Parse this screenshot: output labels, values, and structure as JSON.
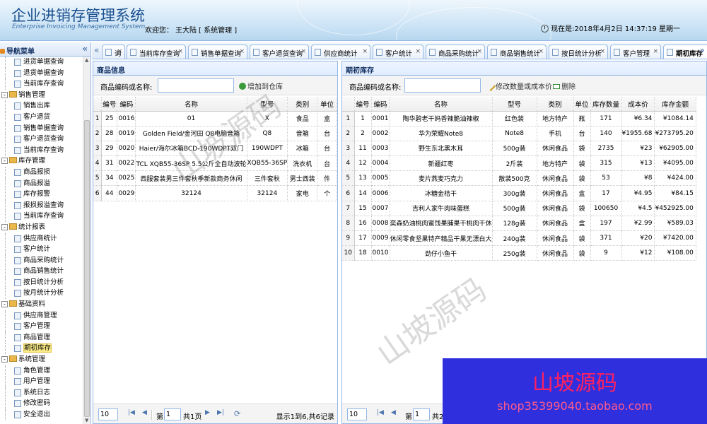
{
  "header": {
    "title": "企业进销存管理系统",
    "subtitle": "Enterprise Invoicing Management System",
    "welcome_prefix": "欢迎您：",
    "user": "王大陆",
    "role": "[  系统管理  ]",
    "datetime": "现在是:2018年4月2日  14:37:19 星期一"
  },
  "sidebar": {
    "title": "导航菜单",
    "collapse_icon": "double-chevron-left-icon",
    "nodes": [
      {
        "type": "leaf",
        "label": "进货单据查询"
      },
      {
        "type": "leaf",
        "label": "退货单据查询"
      },
      {
        "type": "leaf",
        "label": "当前库存查询"
      },
      {
        "type": "group",
        "label": "销售管理"
      },
      {
        "type": "leaf",
        "label": "销售出库"
      },
      {
        "type": "leaf",
        "label": "客户退货"
      },
      {
        "type": "leaf",
        "label": "销售单据查询"
      },
      {
        "type": "leaf",
        "label": "客户退货查询"
      },
      {
        "type": "leaf",
        "label": "当前库存查询"
      },
      {
        "type": "group",
        "label": "库存管理"
      },
      {
        "type": "leaf",
        "label": "商品报损"
      },
      {
        "type": "leaf",
        "label": "商品报溢"
      },
      {
        "type": "leaf",
        "label": "库存报警"
      },
      {
        "type": "leaf",
        "label": "报损报溢查询"
      },
      {
        "type": "leaf",
        "label": "当前库存查询"
      },
      {
        "type": "group",
        "label": "统计报表"
      },
      {
        "type": "leaf",
        "label": "供应商统计"
      },
      {
        "type": "leaf",
        "label": "客户统计"
      },
      {
        "type": "leaf",
        "label": "商品采购统计"
      },
      {
        "type": "leaf",
        "label": "商品销售统计"
      },
      {
        "type": "leaf",
        "label": "按日统计分析"
      },
      {
        "type": "leaf",
        "label": "按月统计分析"
      },
      {
        "type": "group",
        "label": "基础资料"
      },
      {
        "type": "leaf",
        "label": "供应商管理"
      },
      {
        "type": "leaf",
        "label": "客户管理"
      },
      {
        "type": "leaf",
        "label": "商品管理"
      },
      {
        "type": "leaf",
        "label": "期初库存",
        "selected": true
      },
      {
        "type": "group",
        "label": "系统管理"
      },
      {
        "type": "leaf",
        "label": "角色管理"
      },
      {
        "type": "leaf",
        "label": "用户管理"
      },
      {
        "type": "leaf",
        "label": "系统日志"
      },
      {
        "type": "leaf",
        "label": "修改密码"
      },
      {
        "type": "leaf",
        "label": "安全退出"
      }
    ]
  },
  "tabs": [
    {
      "label": "询"
    },
    {
      "label": "当前库存查询"
    },
    {
      "label": "销售单据查询"
    },
    {
      "label": "客户退货查询"
    },
    {
      "label": "供应商统计"
    },
    {
      "label": "客户统计"
    },
    {
      "label": "商品采购统计"
    },
    {
      "label": "商品销售统计"
    },
    {
      "label": "按日统计分析"
    },
    {
      "label": "客户管理"
    },
    {
      "label": "期初库存",
      "active": true
    }
  ],
  "left_panel": {
    "title": "商品信息",
    "search_label": "商品编码或名称:",
    "add_button": "增加到仓库",
    "columns": [
      "编号",
      "编码",
      "名称",
      "型号",
      "类别",
      "单位"
    ],
    "rows": [
      [
        "1",
        "25",
        "0016",
        "01",
        "X",
        "食品",
        "盒"
      ],
      [
        "2",
        "28",
        "0019",
        "Golden Field/金河田 Q8电脑音箱",
        "Q8",
        "音箱",
        "台"
      ],
      [
        "3",
        "29",
        "0020",
        "Haier/海尔冰箱BCD-190WDPT双门",
        "190WDPT",
        "冰箱",
        "台"
      ],
      [
        "4",
        "31",
        "0022",
        "TCL XQB55-36SP 5.5公斤全自动波轮",
        "XQB55-36SP",
        "洗衣机",
        "台"
      ],
      [
        "5",
        "34",
        "0025",
        "西服套装男三件套秋季新款商务休闲",
        "三件套秋",
        "男士西装",
        "件"
      ],
      [
        "6",
        "44",
        "0029",
        "32124",
        "32124",
        "家电",
        "个"
      ]
    ],
    "pager": {
      "page_size": "10",
      "page_prefix": "第",
      "page": "1",
      "page_total": "共1页",
      "summary": "显示1到6,共6记录"
    }
  },
  "right_panel": {
    "title": "期初库存",
    "search_label": "商品编码或名称:",
    "edit_button": "修改数量或成本价",
    "delete_button": "删除",
    "columns": [
      "编号",
      "编码",
      "名称",
      "型号",
      "类别",
      "单位",
      "库存数量",
      "成本价",
      "库存金额"
    ],
    "rows": [
      [
        "1",
        "1",
        "0001",
        "陶华碧老干妈香辣脆油辣椒",
        "红色装",
        "地方特产",
        "瓶",
        "171",
        "¥6.34",
        "¥1084.14"
      ],
      [
        "2",
        "2",
        "0002",
        "华为荣耀Note8",
        "Note8",
        "手机",
        "台",
        "140",
        "¥1955.68",
        "¥273795.20"
      ],
      [
        "3",
        "11",
        "0003",
        "野生东北黑木耳",
        "500g装",
        "休闲食品",
        "袋",
        "2735",
        "¥23",
        "¥62905.00"
      ],
      [
        "4",
        "12",
        "0004",
        "新疆红枣",
        "2斤装",
        "地方特产",
        "袋",
        "315",
        "¥13",
        "¥4095.00"
      ],
      [
        "5",
        "13",
        "0005",
        "麦片燕麦巧克力",
        "散装500克",
        "休闲食品",
        "袋",
        "53",
        "¥8",
        "¥424.00"
      ],
      [
        "6",
        "14",
        "0006",
        "冰糖金桔干",
        "300g装",
        "休闲食品",
        "盒",
        "17",
        "¥4.95",
        "¥84.15"
      ],
      [
        "7",
        "15",
        "0007",
        "吉利人家牛肉味蛋糕",
        "500g装",
        "休闲食品",
        "袋",
        "100650",
        "¥4.5",
        "¥452925.00"
      ],
      [
        "8",
        "16",
        "0008",
        "奕森奶油桃肉蜜饯果脯果干桃肉干休",
        "128g装",
        "休闲食品",
        "盒",
        "197",
        "¥2.99",
        "¥589.03"
      ],
      [
        "9",
        "17",
        "0009",
        "休闲零食坚果特产精品干果无漂白大",
        "240g装",
        "休闲食品",
        "袋",
        "371",
        "¥20",
        "¥7420.00"
      ],
      [
        "10",
        "18",
        "0010",
        "劲仔小鱼干",
        "250g装",
        "休闲食品",
        "袋",
        "9",
        "¥12",
        "¥108.00"
      ]
    ],
    "pager": {
      "page_size": "10",
      "page_prefix": "第",
      "page": "1",
      "page_total": "共2页"
    }
  },
  "watermark": "山坡源码",
  "ad": {
    "title": "山坡源码",
    "shop": "shop35399040.taobao.com"
  }
}
